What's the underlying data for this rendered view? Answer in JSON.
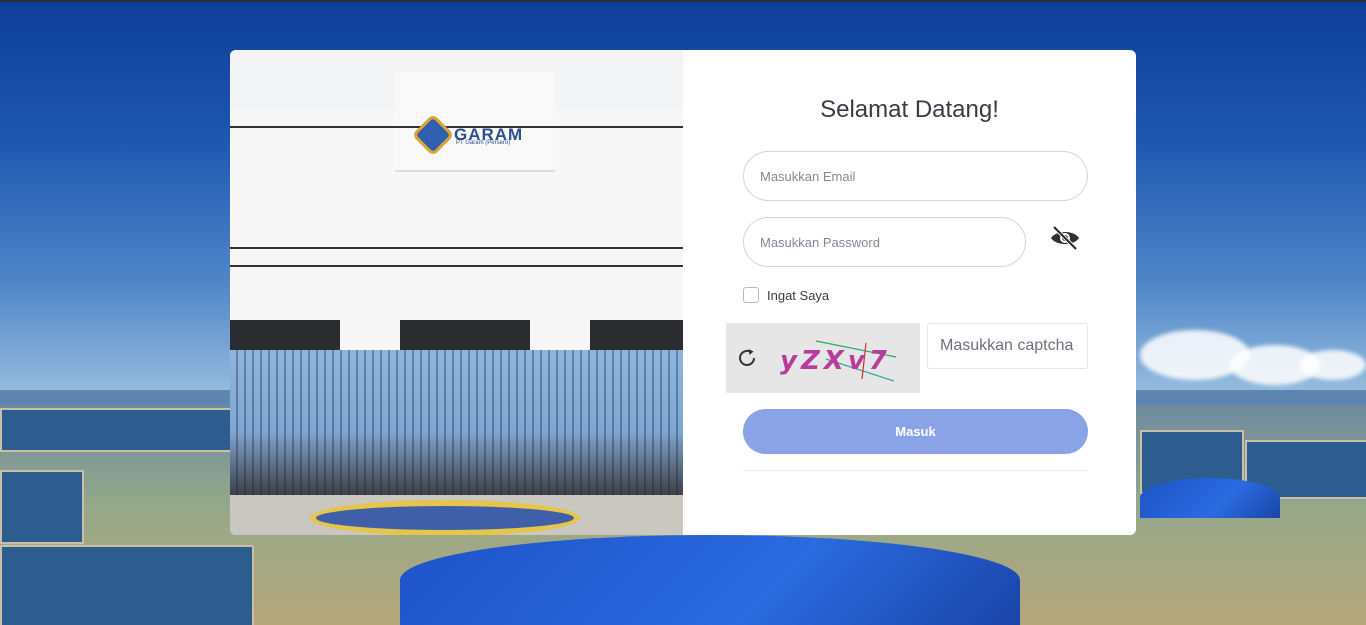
{
  "form": {
    "title": "Selamat Datang!",
    "email_placeholder": "Masukkan Email",
    "password_placeholder": "Masukkan Password",
    "remember_label": "Ingat Saya",
    "captcha_text": "yZXv7",
    "captcha_placeholder": "Masukkan captcha",
    "submit_label": "Masuk"
  },
  "photo": {
    "logo_text": "GARAM",
    "logo_subtext": "PT Garam (Persero)"
  },
  "icons": {
    "password_toggle": "eye-slash-icon",
    "captcha_refresh": "refresh-icon",
    "logo": "garam-logo-icon"
  },
  "colors": {
    "submit_button": "#8aa3e6",
    "title_text": "#3a3b45",
    "input_border": "#d1d3e2"
  }
}
